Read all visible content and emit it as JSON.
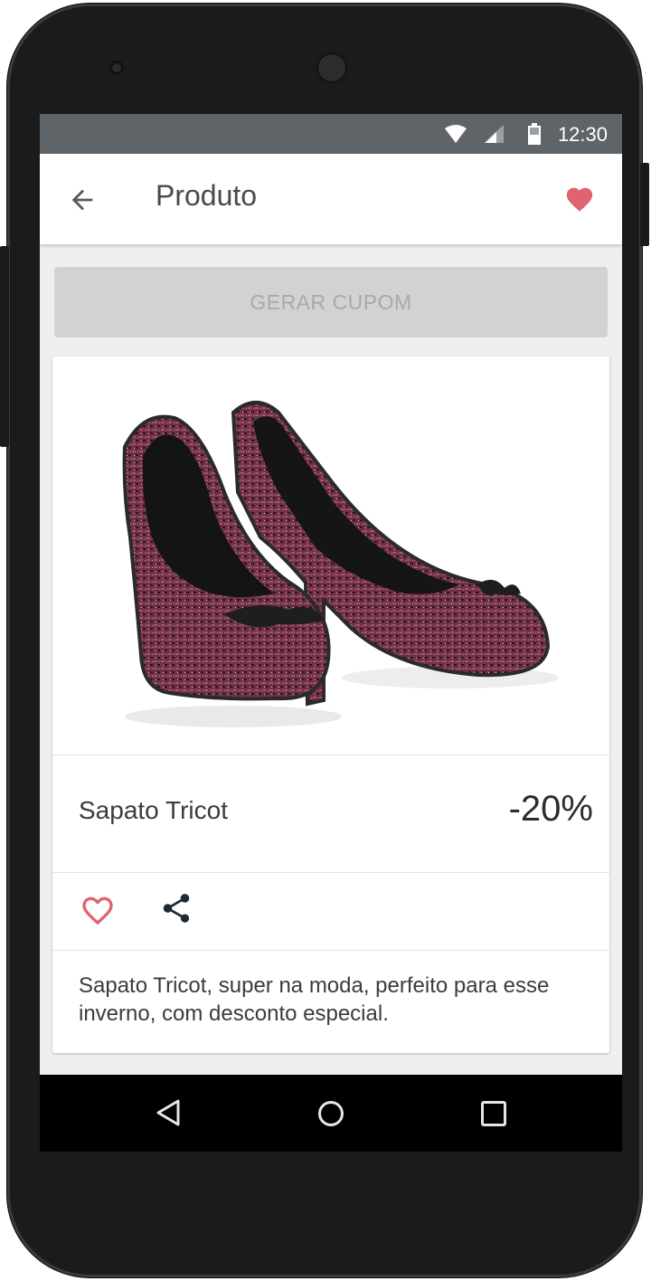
{
  "status_bar": {
    "time": "12:30"
  },
  "app_bar": {
    "title": "Produto"
  },
  "coupon_button": {
    "label": "GERAR CUPOM"
  },
  "product": {
    "name": "Sapato Tricot",
    "discount": "-20%",
    "description": "Sapato Tricot, super na moda, perfeito para esse inverno, com desconto especial."
  },
  "icons": {
    "back": "arrow-back-icon",
    "favorite": "heart-filled-icon",
    "like": "heart-outline-icon",
    "share": "share-icon",
    "nav": [
      "nav-back-icon",
      "nav-home-icon",
      "nav-recents-icon"
    ]
  },
  "colors": {
    "accent": "#e0646f",
    "status_bar": "#5f6469",
    "coupon_disabled_bg": "#d2d2d4",
    "coupon_disabled_text": "#a9a9ab"
  }
}
